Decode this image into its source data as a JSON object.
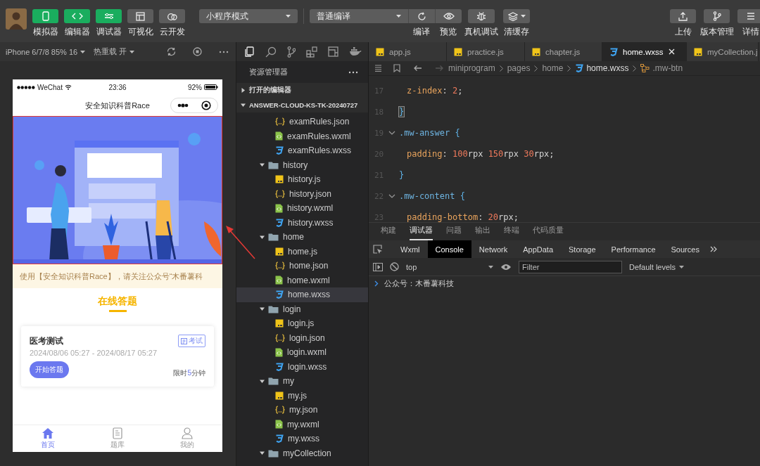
{
  "toolbar": {
    "tools": [
      {
        "label": "模拟器",
        "on": true
      },
      {
        "label": "编辑器",
        "on": true
      },
      {
        "label": "调试器",
        "on": true
      },
      {
        "label": "可视化",
        "on": false
      },
      {
        "label": "云开发",
        "on": false
      }
    ],
    "mode_select": "小程序模式",
    "compile_select": "普通编译",
    "actions": [
      "编译",
      "预览",
      "真机调试",
      "清缓存"
    ],
    "right_actions": [
      "上传",
      "版本管理",
      "详情"
    ]
  },
  "simulator": {
    "device": "iPhone 6/7/8 85% 16",
    "hot_reload": "热重载 开",
    "phone": {
      "status": {
        "carrier": "WeChat",
        "time": "23:36",
        "battery": "92%"
      },
      "nav_title": "安全知识科普Race",
      "notice": "使用【安全知识科普Race】，请关注公众号“木番薯科",
      "section_title": "在线答题",
      "exams": [
        {
          "title": "医考测试",
          "tag": "考试",
          "dates": "2024/08/06 05:27 - 2024/08/17 05:27",
          "start_button": "开始答题",
          "time_limit": {
            "prefix": "限时",
            "value": "5",
            "suffix": "分钟"
          }
        }
      ],
      "tabbar": [
        {
          "label": "首页",
          "selected": true
        },
        {
          "label": "题库",
          "selected": false
        },
        {
          "label": "我的",
          "selected": false
        }
      ]
    }
  },
  "explorer": {
    "title": "资源管理器",
    "sections": [
      {
        "label": "打开的编辑器",
        "expanded": false
      },
      {
        "label": "ANSWER-CLOUD-KS-TK-20240727",
        "expanded": true
      }
    ],
    "tree": [
      {
        "kind": "group",
        "children": [
          {
            "kind": "json",
            "name": "examRules.json",
            "selected": false
          },
          {
            "kind": "wxml",
            "name": "examRules.wxml",
            "selected": false
          },
          {
            "kind": "wxss",
            "name": "examRules.wxss",
            "selected": false
          }
        ]
      },
      {
        "kind": "folder",
        "name": "history",
        "expanded": true,
        "selected": false,
        "children": [
          {
            "kind": "js",
            "name": "history.js",
            "selected": false
          },
          {
            "kind": "json",
            "name": "history.json",
            "selected": false
          },
          {
            "kind": "wxml",
            "name": "history.wxml",
            "selected": false
          },
          {
            "kind": "wxss",
            "name": "history.wxss",
            "selected": false
          }
        ]
      },
      {
        "kind": "folder",
        "name": "home",
        "expanded": true,
        "selected": false,
        "children": [
          {
            "kind": "js",
            "name": "home.js",
            "selected": false
          },
          {
            "kind": "json",
            "name": "home.json",
            "selected": false
          },
          {
            "kind": "wxml",
            "name": "home.wxml",
            "selected": false
          },
          {
            "kind": "wxss",
            "name": "home.wxss",
            "selected": true
          }
        ]
      },
      {
        "kind": "folder",
        "name": "login",
        "expanded": true,
        "selected": false,
        "children": [
          {
            "kind": "js",
            "name": "login.js",
            "selected": false
          },
          {
            "kind": "json",
            "name": "login.json",
            "selected": false
          },
          {
            "kind": "wxml",
            "name": "login.wxml",
            "selected": false
          },
          {
            "kind": "wxss",
            "name": "login.wxss",
            "selected": false
          }
        ]
      },
      {
        "kind": "folder",
        "name": "my",
        "expanded": true,
        "selected": false,
        "children": [
          {
            "kind": "js",
            "name": "my.js",
            "selected": false
          },
          {
            "kind": "json",
            "name": "my.json",
            "selected": false
          },
          {
            "kind": "wxml",
            "name": "my.wxml",
            "selected": false
          },
          {
            "kind": "wxss",
            "name": "my.wxss",
            "selected": false
          }
        ]
      },
      {
        "kind": "folder",
        "name": "myCollection",
        "expanded": true,
        "selected": false
      }
    ]
  },
  "editor": {
    "tabs": [
      {
        "kind": "js",
        "name": "app.js",
        "selected": false
      },
      {
        "kind": "js",
        "name": "practice.js",
        "selected": false
      },
      {
        "kind": "js",
        "name": "chapter.js",
        "selected": false
      },
      {
        "kind": "wxss",
        "name": "home.wxss",
        "selected": true
      },
      {
        "kind": "js",
        "name": "myCollection.j",
        "selected": false
      }
    ],
    "breadcrumb": [
      {
        "kind": "dir",
        "text": "miniprogram"
      },
      {
        "kind": "dir",
        "text": "pages"
      },
      {
        "kind": "dir",
        "text": "home"
      },
      {
        "kind": "wxss",
        "text": "home.wxss"
      },
      {
        "kind": "symbol",
        "text": ".mw-btn"
      }
    ],
    "code": [
      {
        "number": "17",
        "kind": "decl",
        "tokens": [
          {
            "kind": "prop",
            "text": "z-index"
          },
          {
            "kind": "punct",
            "text": ": "
          },
          {
            "kind": "num",
            "text": "2"
          },
          {
            "kind": "punct",
            "text": ";"
          }
        ]
      },
      {
        "number": "18",
        "kind": "close",
        "matched": true,
        "tokens": [
          {
            "kind": "brace",
            "text": "}"
          }
        ]
      },
      {
        "number": "19",
        "kind": "rule",
        "tokens": [
          {
            "kind": "selector",
            "text": ".mw-answer"
          },
          {
            "kind": "brace",
            "text": " {"
          }
        ]
      },
      {
        "number": "20",
        "kind": "decl",
        "tokens": [
          {
            "kind": "prop",
            "text": "padding"
          },
          {
            "kind": "punct",
            "text": ": "
          },
          {
            "kind": "num",
            "text": "100"
          },
          {
            "kind": "unit",
            "text": "rpx "
          },
          {
            "kind": "num",
            "text": "150"
          },
          {
            "kind": "unit",
            "text": "rpx "
          },
          {
            "kind": "num",
            "text": "30"
          },
          {
            "kind": "unit",
            "text": "rpx;"
          }
        ]
      },
      {
        "number": "21",
        "kind": "close",
        "matched": false,
        "tokens": [
          {
            "kind": "brace",
            "text": "}"
          }
        ]
      },
      {
        "number": "22",
        "kind": "rule",
        "tokens": [
          {
            "kind": "selector",
            "text": ".mw-content"
          },
          {
            "kind": "brace",
            "text": " {"
          }
        ]
      },
      {
        "number": "23",
        "kind": "decl",
        "tokens": [
          {
            "kind": "prop",
            "text": "padding-bottom"
          },
          {
            "kind": "punct",
            "text": ": "
          },
          {
            "kind": "num",
            "text": "20"
          },
          {
            "kind": "unit",
            "text": "rpx;"
          }
        ]
      }
    ]
  },
  "panel": {
    "tabs": [
      {
        "label": "构建",
        "selected": false
      },
      {
        "label": "调试器",
        "selected": true
      },
      {
        "label": "问题",
        "selected": false
      },
      {
        "label": "输出",
        "selected": false
      },
      {
        "label": "终端",
        "selected": false
      },
      {
        "label": "代码质量",
        "selected": false
      }
    ],
    "devtools_tabs": [
      {
        "label": "Wxml",
        "selected": false
      },
      {
        "label": "Console",
        "selected": true
      },
      {
        "label": "Network",
        "selected": false
      },
      {
        "label": "AppData",
        "selected": false
      },
      {
        "label": "Storage",
        "selected": false
      },
      {
        "label": "Performance",
        "selected": false
      },
      {
        "label": "Sources",
        "selected": false
      }
    ],
    "context": "top",
    "filter": {
      "placeholder": "Filter"
    },
    "levels": "Default levels",
    "console": [
      "公众号：木番薯科技"
    ]
  }
}
